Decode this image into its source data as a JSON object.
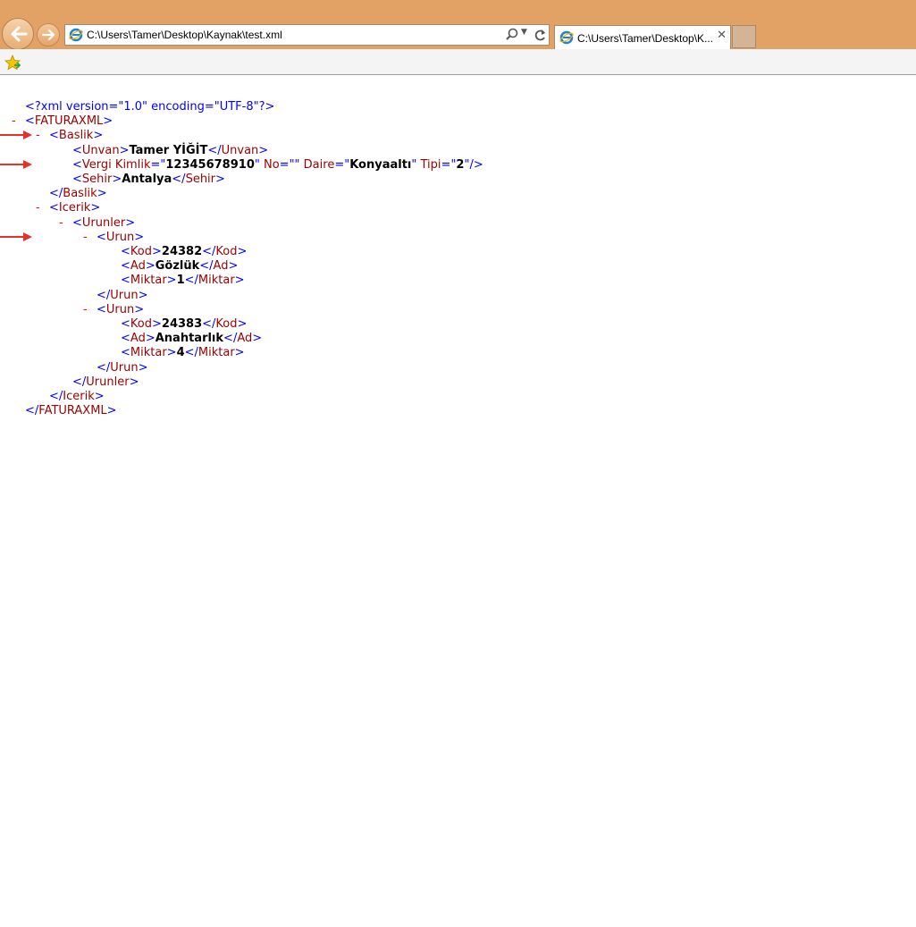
{
  "browser": {
    "address": "C:\\Users\\Tamer\\Desktop\\Kaynak\\test.xml",
    "tab_title": "C:\\Users\\Tamer\\Desktop\\K...",
    "tab_close": "✕"
  },
  "xml": {
    "decl": "<?xml version=\"1.0\" encoding=\"UTF-8\"?>",
    "toggle": "-",
    "root": "FATURAXML",
    "baslik": "Baslik",
    "unvan_tag": "Unvan",
    "unvan_val": "Tamer YİĞİT",
    "vergi_tag": "Vergi",
    "kimlik_attr": "Kimlik",
    "kimlik_val": "12345678910",
    "no_attr": "No",
    "no_val": "",
    "daire_attr": "Daire",
    "daire_val": "Konyaaltı",
    "tipi_attr": "Tipi",
    "tipi_val": "2",
    "sehir_tag": "Sehir",
    "sehir_val": "Antalya",
    "icerik": "Icerik",
    "urunler": "Urunler",
    "urun": "Urun",
    "kod_tag": "Kod",
    "ad_tag": "Ad",
    "miktar_tag": "Miktar",
    "items": [
      {
        "kod": "24382",
        "ad": "Gözlük",
        "miktar": "1"
      },
      {
        "kod": "24383",
        "ad": "Anahtarlık",
        "miktar": "4"
      }
    ]
  }
}
